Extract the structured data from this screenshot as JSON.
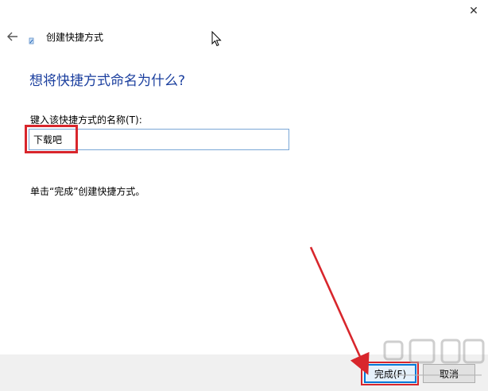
{
  "window": {
    "close_glyph": "✕"
  },
  "header": {
    "title": "创建快捷方式"
  },
  "main": {
    "heading": "想将快捷方式命名为什么?",
    "field_label": "键入该快捷方式的名称(T):",
    "name_value": "下载吧",
    "finish_hint": "单击“完成”创建快捷方式。"
  },
  "footer": {
    "finish_button": "完成(F)",
    "cancel_button": "取消"
  },
  "annotations": {
    "highlight_color": "#d8262c",
    "arrow_color": "#d8262c"
  },
  "icons": {
    "back": "back-arrow-icon",
    "wizard": "shortcut-wizard-icon",
    "cursor": "mouse-cursor-icon"
  }
}
